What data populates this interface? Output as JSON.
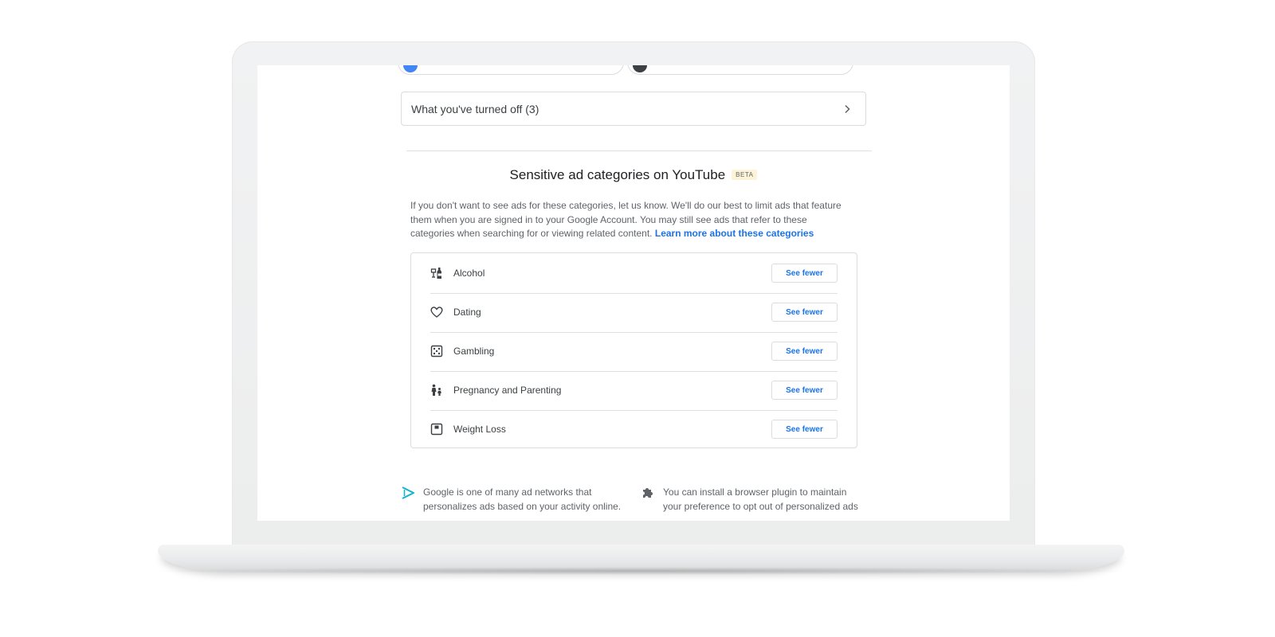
{
  "turned_off": {
    "label": "What you've turned off (3)",
    "icon": "chevron-right-icon"
  },
  "sensitive_section": {
    "title": "Sensitive ad categories on YouTube",
    "badge": "BETA",
    "description": "If you don't want to see ads for these categories, let us know. We'll do our best to limit ads that feature them when you are signed in to your Google Account. You may still see ads that refer to these categories when searching for or viewing related content.",
    "learn_more_link": "Learn more about these categories",
    "categories": [
      {
        "label": "Alcohol",
        "icon": "alcohol-icon",
        "button": "See fewer"
      },
      {
        "label": "Dating",
        "icon": "heart-icon",
        "button": "See fewer"
      },
      {
        "label": "Gambling",
        "icon": "dice-icon",
        "button": "See fewer"
      },
      {
        "label": "Pregnancy and Parenting",
        "icon": "parent-child-icon",
        "button": "See fewer"
      },
      {
        "label": "Weight Loss",
        "icon": "scale-icon",
        "button": "See fewer"
      }
    ]
  },
  "footer": {
    "left": {
      "icon": "ad-networks-icon",
      "text": "Google is one of many ad networks that personalizes ads based on your activity online."
    },
    "right": {
      "icon": "puzzle-piece-icon",
      "text": "You can install a browser plugin to maintain your preference to opt out of personalized ads"
    }
  },
  "colors": {
    "link_blue": "#1a73e8",
    "text_dark": "#202124",
    "text_gray": "#5f6368",
    "border": "#dadce0",
    "beta_bg": "#fdf3d6",
    "top_left_dot": "#4285f4",
    "top_right_dot": "#3c4043",
    "footer_left_icon": "#12b5cb"
  }
}
